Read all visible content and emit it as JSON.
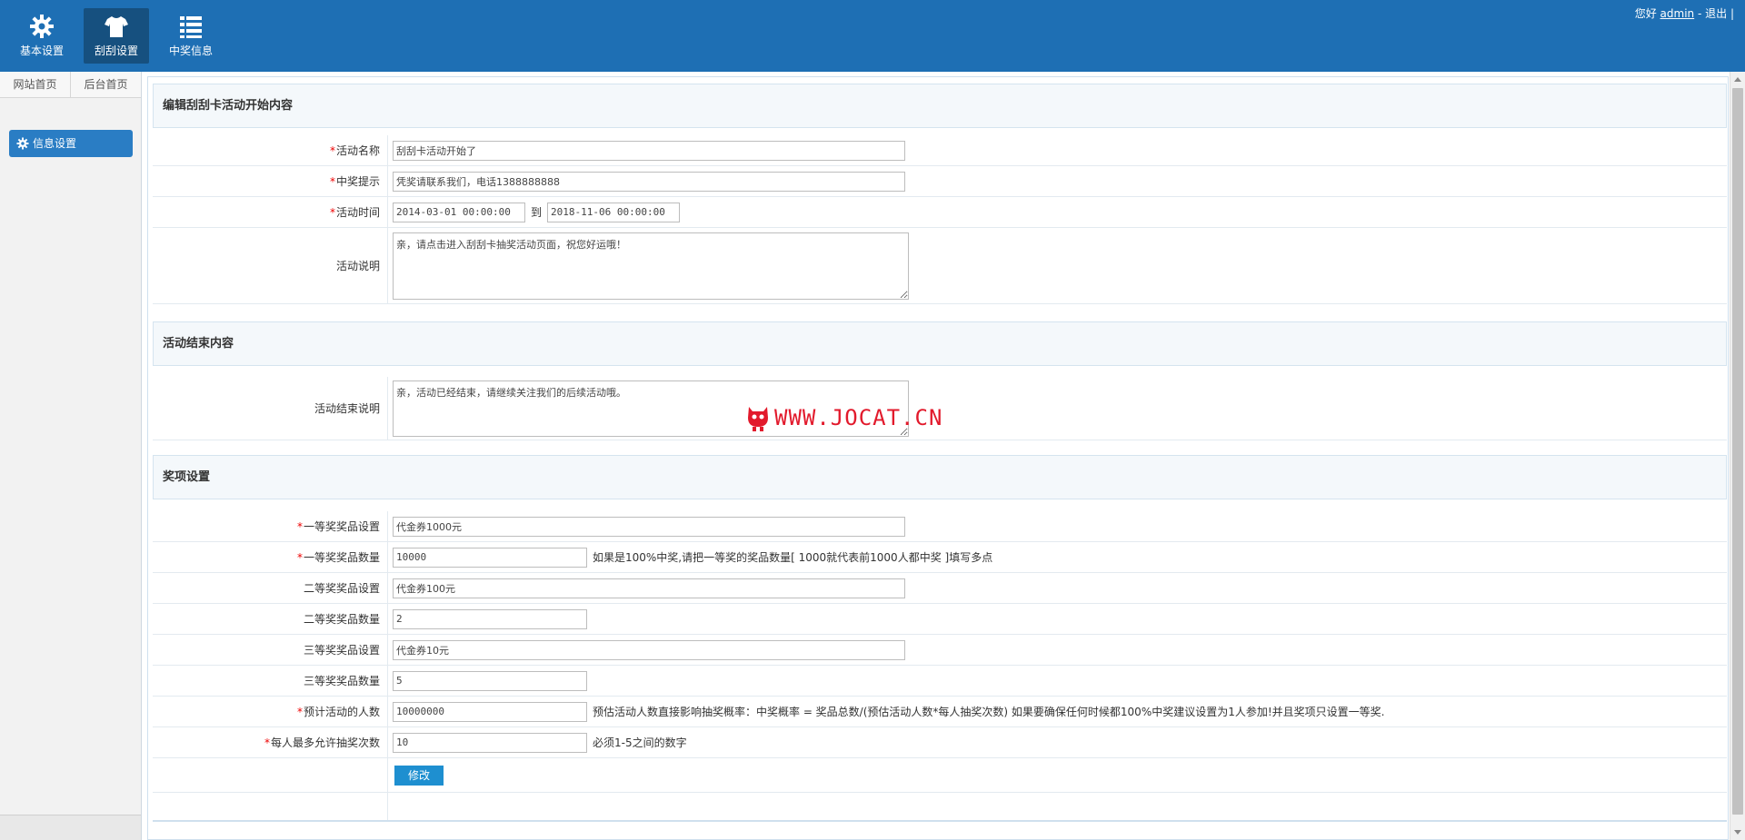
{
  "header": {
    "nav": [
      {
        "label": "基本设置",
        "icon": "gear-icon"
      },
      {
        "label": "刮刮设置",
        "icon": "tshirt-icon"
      },
      {
        "label": "中奖信息",
        "icon": "list-icon"
      }
    ],
    "greeting": "您好",
    "username": "admin",
    "logout_sep": " - ",
    "logout": "退出",
    "trailing": " |"
  },
  "sidebar": {
    "tabs": [
      "网站首页",
      "后台首页"
    ],
    "menu_item": "信息设置"
  },
  "form": {
    "section_start_title": "编辑刮刮卡活动开始内容",
    "section_end_title": "活动结束内容",
    "section_prize_title": "奖项设置",
    "required_mark": "*",
    "fields": {
      "activity_name": {
        "label": "活动名称",
        "value": "刮刮卡活动开始了"
      },
      "win_tip": {
        "label": "中奖提示",
        "value": "凭奖请联系我们，电话1388888888"
      },
      "activity_time": {
        "label": "活动时间",
        "start": "2014-03-01 00:00:00",
        "to": "到",
        "end": "2018-11-06 00:00:00"
      },
      "activity_desc": {
        "label": "活动说明",
        "value": "亲，请点击进入刮刮卡抽奖活动页面，祝您好运哦！"
      },
      "end_desc": {
        "label": "活动结束说明",
        "value": "亲，活动已经结束，请继续关注我们的后续活动哦。"
      },
      "prize1_name": {
        "label": "一等奖奖品设置",
        "value": "代金券1000元"
      },
      "prize1_count": {
        "label": "一等奖奖品数量",
        "value": "10000",
        "hint": "如果是100%中奖,请把一等奖的奖品数量[ 1000就代表前1000人都中奖 ]填写多点"
      },
      "prize2_name": {
        "label": "二等奖奖品设置",
        "value": "代金券100元"
      },
      "prize2_count": {
        "label": "二等奖奖品数量",
        "value": "2"
      },
      "prize3_name": {
        "label": "三等奖奖品设置",
        "value": "代金券10元"
      },
      "prize3_count": {
        "label": "三等奖奖品数量",
        "value": "5"
      },
      "expected_people": {
        "label": "预计活动的人数",
        "value": "10000000",
        "hint": "预估活动人数直接影响抽奖概率：中奖概率 = 奖品总数/(预估活动人数*每人抽奖次数) 如果要确保任何时候都100%中奖建议设置为1人参加!并且奖项只设置一等奖."
      },
      "max_draws": {
        "label": "每人最多允许抽奖次数",
        "value": "10",
        "hint": "必须1-5之间的数字"
      }
    },
    "submit": "修改"
  },
  "watermark": {
    "text": "WWW.JOCAT.CN"
  },
  "colors": {
    "header": "#1e6fb4",
    "active_nav": "#16507f",
    "sidebar_item": "#2a7dc4",
    "button": "#1e8fd0",
    "required": "#ee0000",
    "watermark": "#e21a2c"
  }
}
